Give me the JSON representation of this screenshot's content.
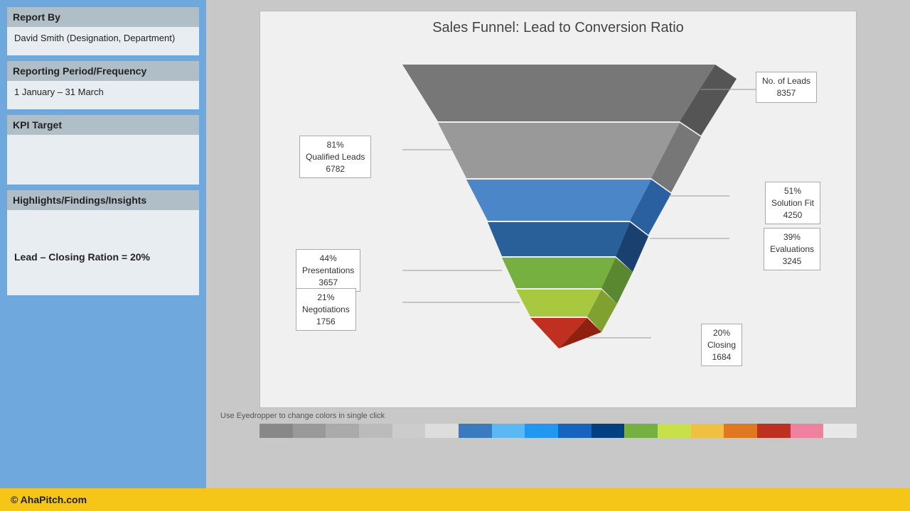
{
  "sidebar": {
    "report_by_label": "Report By",
    "report_by_value": "David Smith (Designation, Department)",
    "period_label": "Reporting Period/Frequency",
    "period_value": "1 January – 31 March",
    "kpi_label": "KPI Target",
    "kpi_value": "",
    "highlights_label": "Highlights/Findings/Insights",
    "highlights_value": "Lead – Closing Ration = 20%"
  },
  "chart": {
    "title": "Sales Funnel: Lead to Conversion Ratio",
    "funnel_stages": [
      {
        "label": "No. of Leads",
        "value": "8357",
        "percent": "",
        "color": "#888888"
      },
      {
        "label": "Qualified Leads",
        "value": "6782",
        "percent": "81%",
        "color": "#aaaaaa"
      },
      {
        "label": "Solution Fit",
        "value": "4250",
        "percent": "51%",
        "color": "#4a86c8"
      },
      {
        "label": "Evaluations",
        "value": "3245",
        "percent": "39%",
        "color": "#2a6099"
      },
      {
        "label": "Presentations",
        "value": "3657",
        "percent": "44%",
        "color": "#4a86c8"
      },
      {
        "label": "Negotiations",
        "value": "1756",
        "percent": "21%",
        "color": "#76b041"
      },
      {
        "label": "Closing",
        "value": "1684",
        "percent": "20%",
        "color": "#c0392b"
      }
    ]
  },
  "footer": {
    "text": "© AhaPitch.com"
  },
  "palette": {
    "colors": [
      "#888",
      "#999",
      "#aaa",
      "#bbb",
      "#ccc",
      "#ddd",
      "#3a7abf",
      "#5bb8f5",
      "#2196f3",
      "#1565c0",
      "#004080",
      "#76b041",
      "#c8e04a",
      "#f0c040",
      "#e07820",
      "#c03020",
      "#f080a0",
      "#e0e0e0"
    ],
    "eyedropper_text": "Use Eyedropper to change colors in single click"
  }
}
